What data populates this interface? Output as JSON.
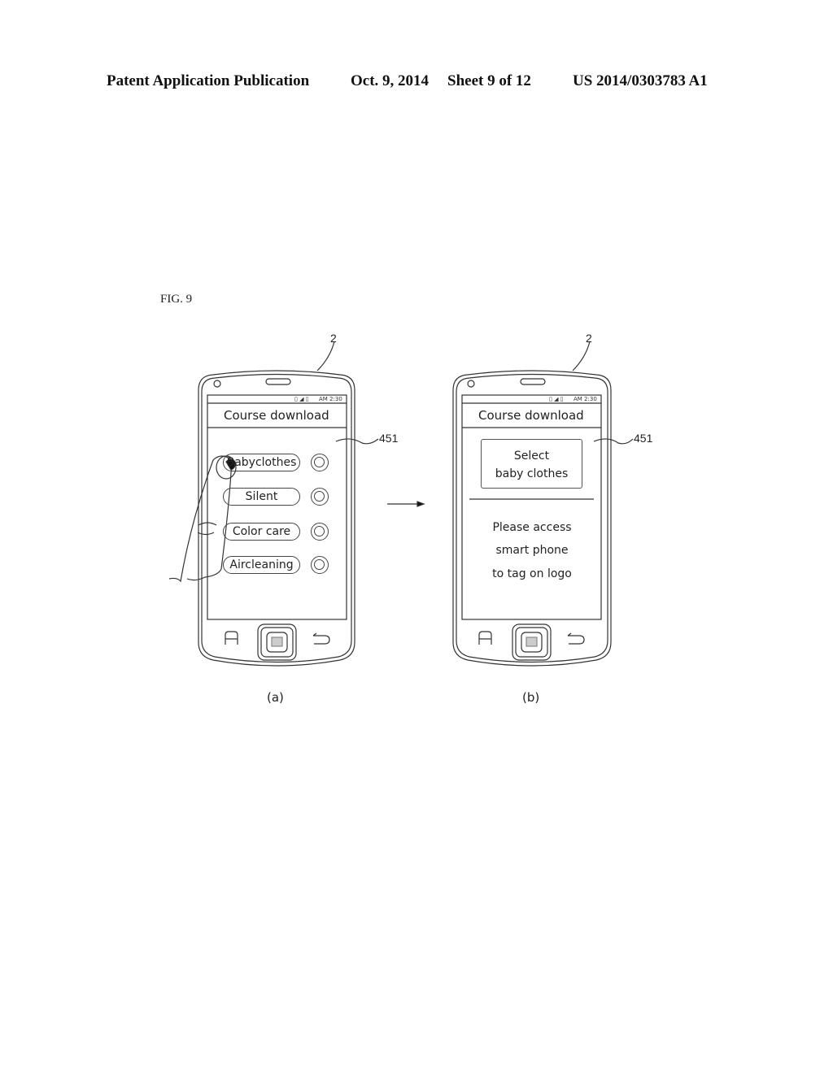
{
  "header": {
    "publication": "Patent Application Publication",
    "date": "Oct. 9, 2014",
    "sheet": "Sheet 9 of 12",
    "number": "US 2014/0303783 A1"
  },
  "figure": {
    "label": "FIG. 9",
    "device_ref": "2",
    "screen_ref": "451"
  },
  "panel_a": {
    "caption": "(a)",
    "status_time": "AM 2:30",
    "title": "Course download",
    "options": [
      {
        "label": "Babyclothes",
        "selected": true
      },
      {
        "label": "Silent",
        "selected": false
      },
      {
        "label": "Color care",
        "selected": false
      },
      {
        "label": "Aircleaning",
        "selected": false
      }
    ]
  },
  "panel_b": {
    "caption": "(b)",
    "status_time": "AM 2:30",
    "title": "Course download",
    "selection_line1": "Select",
    "selection_line2": "baby clothes",
    "message_lines": [
      "Please access",
      "smart phone",
      "to tag on logo"
    ]
  },
  "icons": {
    "menu": "menu-icon",
    "home": "home-button-icon",
    "back": "back-icon",
    "arrow": "right-arrow-icon",
    "finger": "finger-icon"
  }
}
